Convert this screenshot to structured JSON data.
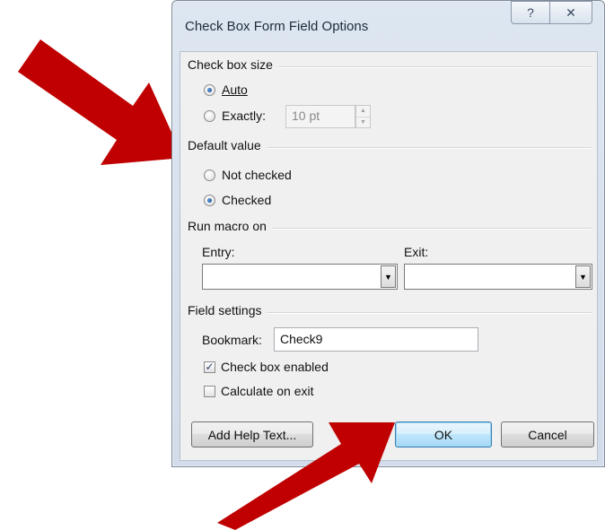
{
  "window": {
    "title": "Check Box Form Field Options",
    "help_glyph": "?",
    "close_glyph": "✕"
  },
  "check_box_size": {
    "label": "Check box size",
    "auto_label": "Auto",
    "exactly_label": "Exactly:",
    "exactly_value": "10 pt",
    "selected": "Auto"
  },
  "default_value": {
    "label": "Default value",
    "not_checked_label": "Not checked",
    "checked_label": "Checked",
    "selected": "Checked"
  },
  "run_macro": {
    "label": "Run macro on",
    "entry_label": "Entry:",
    "entry_value": "",
    "exit_label": "Exit:",
    "exit_value": ""
  },
  "field_settings": {
    "label": "Field settings",
    "bookmark_label": "Bookmark:",
    "bookmark_value": "Check9",
    "enabled_label": "Check box enabled",
    "enabled_checked": true,
    "calculate_label": "Calculate on exit",
    "calculate_checked": false
  },
  "buttons": {
    "add_help_text": "Add Help Text...",
    "ok": "OK",
    "cancel": "Cancel"
  },
  "annotations": {
    "arrow_color": "#c00000"
  }
}
